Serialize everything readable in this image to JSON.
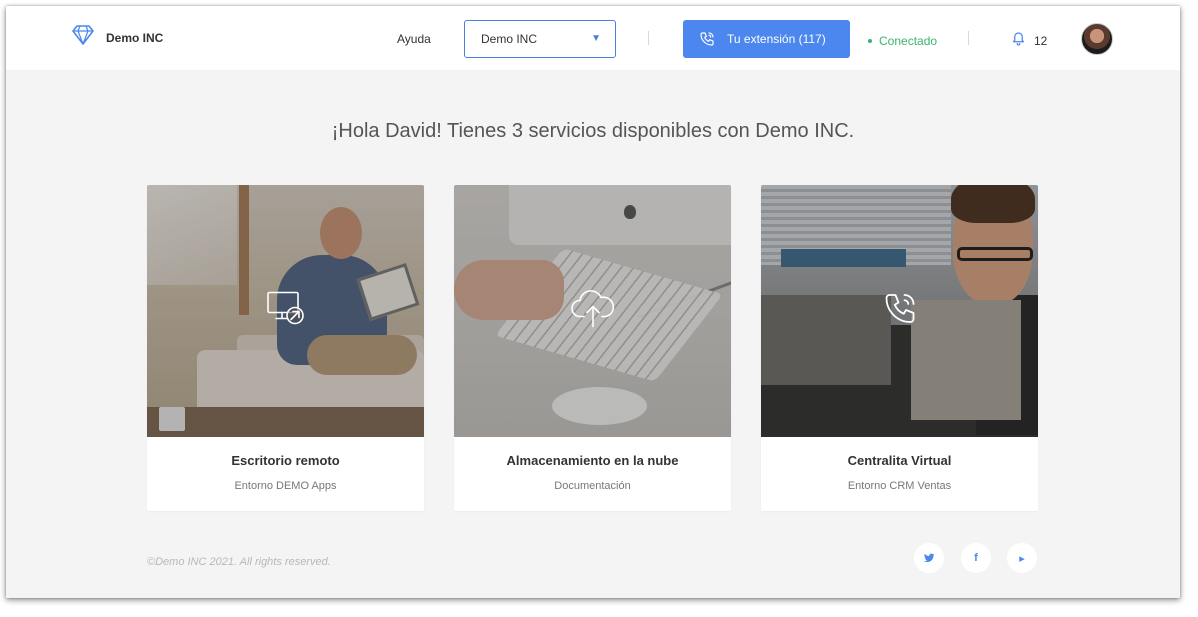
{
  "header": {
    "brand_name": "Demo INC",
    "help_label": "Ayuda",
    "company_select": {
      "selected": "Demo INC"
    },
    "extension_button_label": "Tu extensión (117)",
    "status_label": "Conectado",
    "notifications_count": "12"
  },
  "main": {
    "greeting": "¡Hola David! Tienes 3 servicios disponibles con Demo INC.",
    "services": [
      {
        "title": "Escritorio remoto",
        "subtitle": "Entorno DEMO Apps",
        "icon": "remote-desktop-icon"
      },
      {
        "title": "Almacenamiento en la nube",
        "subtitle": "Documentación",
        "icon": "cloud-upload-icon"
      },
      {
        "title": "Centralita Virtual",
        "subtitle": "Entorno CRM Ventas",
        "icon": "phone-call-icon"
      }
    ]
  },
  "footer": {
    "copyright": "©Demo INC 2021. All rights reserved.",
    "social": [
      {
        "name": "twitter-icon",
        "glyph": "🐦"
      },
      {
        "name": "facebook-icon",
        "glyph": "f"
      },
      {
        "name": "youtube-icon",
        "glyph": "▸"
      }
    ]
  },
  "colors": {
    "accent": "#4b87ee",
    "status_ok": "#3cb371",
    "background": "#f4f4f5"
  }
}
